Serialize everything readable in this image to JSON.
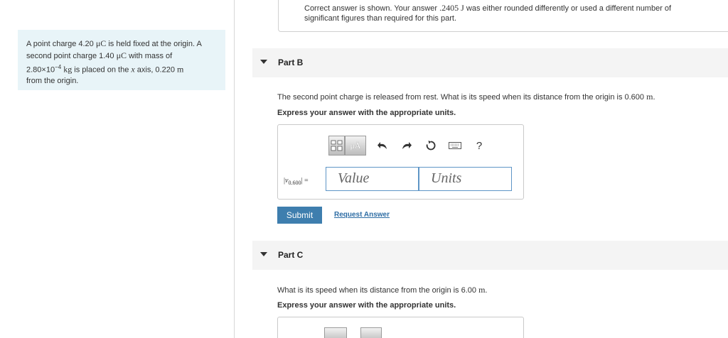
{
  "problem": {
    "line1_a": "A point charge 4.20 ",
    "line1_unit": "μC",
    "line1_b": " is held fixed at the origin. A",
    "line2_a": "second point charge 1.40 ",
    "line2_unit": "μC",
    "line2_b": " with mass of",
    "line3_a": "2.80×10",
    "line3_exp": "−4",
    "line3_unit": " kg",
    "line3_b": " is placed on the ",
    "line3_var": "x",
    "line3_c": " axis, 0.220 ",
    "line3_unit2": "m",
    "line4": "from the origin."
  },
  "feedback": {
    "line1_a": "Correct answer is shown. Your answer ",
    "line1_value": ".2405 J",
    "line1_b": " was either rounded differently or used a different number of",
    "line2": "significant figures than required for this part."
  },
  "partB": {
    "title": "Part B",
    "question_a": "The second point charge is released from rest. What is its speed when its distance from the origin is 0.600 ",
    "question_unit": "m",
    "question_b": ".",
    "instruction": "Express your answer with the appropriate units.",
    "var_symbol": "v",
    "var_sub": "0.600",
    "var_eq": " =",
    "value_placeholder": "Value",
    "units_placeholder": "Units",
    "toolbar": {
      "units_btn": "μÅ",
      "help": "?"
    },
    "submit_label": "Submit",
    "request_label": "Request Answer"
  },
  "partC": {
    "title": "Part C",
    "question_a": "What is its speed when its distance from the origin is 6.00 ",
    "question_unit": "m",
    "question_b": ".",
    "instruction": "Express your answer with the appropriate units."
  },
  "colors": {
    "problem_bg": "#e8f4f8",
    "submit_bg": "#3e7eae",
    "link": "#2e6da4",
    "input_border": "#5e95c6"
  }
}
